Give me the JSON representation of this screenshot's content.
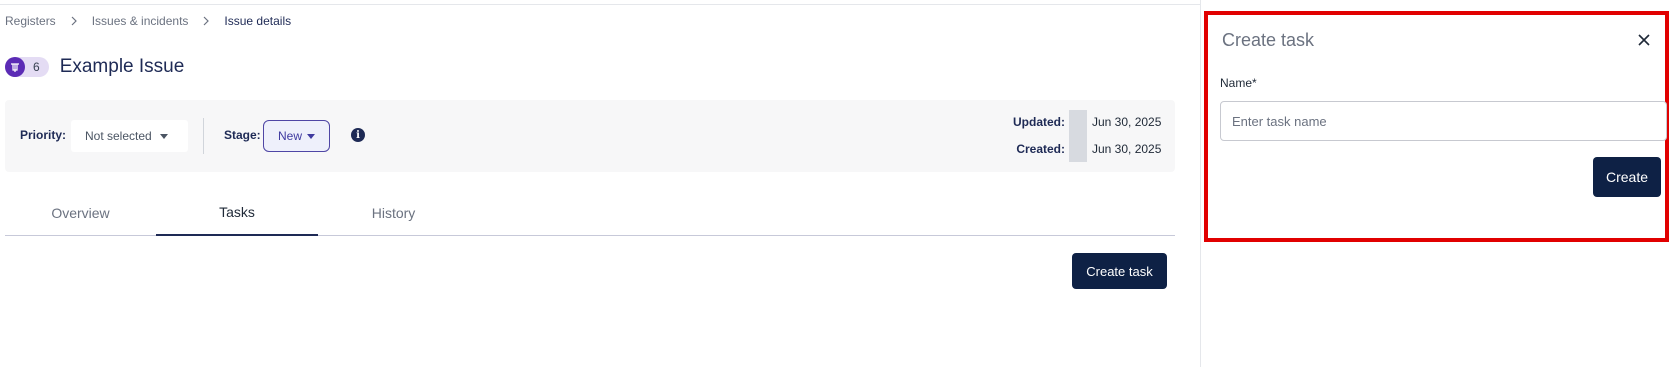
{
  "breadcrumb": {
    "items": [
      "Registers",
      "Issues & incidents"
    ],
    "current": "Issue details"
  },
  "issue": {
    "id_count": "6",
    "title": "Example Issue"
  },
  "info_bar": {
    "priority_label": "Priority:",
    "priority_value": "Not selected",
    "stage_label": "Stage:",
    "stage_value": "New",
    "updated_label": "Updated:",
    "updated_value": "Jun 30, 2025",
    "created_label": "Created:",
    "created_value": "Jun 30, 2025"
  },
  "tabs": [
    {
      "label": "Overview",
      "active": false
    },
    {
      "label": "Tasks",
      "active": true
    },
    {
      "label": "History",
      "active": false
    }
  ],
  "actions": {
    "create_task_label": "Create task"
  },
  "panel": {
    "title": "Create task",
    "name_label": "Name*",
    "name_placeholder": "Enter task name",
    "name_value": "",
    "create_label": "Create"
  },
  "colors": {
    "primary": "#0e2145",
    "highlight_border": "#e10000",
    "stage_accent": "#4f46a5",
    "id_icon": "#5b2bb5"
  }
}
